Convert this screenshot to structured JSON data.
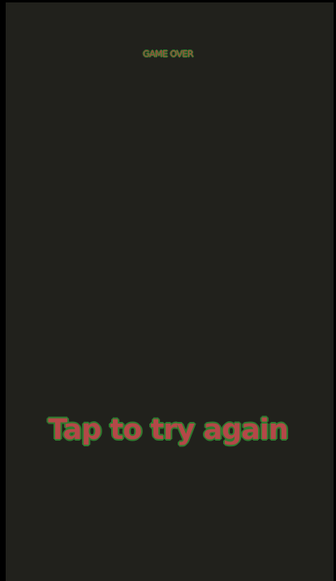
{
  "game": {
    "status_label": "GAME OVER",
    "prompt": "Tap to try again"
  },
  "colors": {
    "background": "#21211c",
    "frame": "#000000",
    "text_fill": "#b44848",
    "text_outline": "#2f7d2f"
  }
}
